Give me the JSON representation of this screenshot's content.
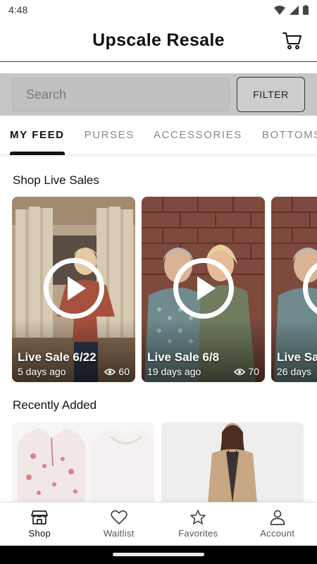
{
  "status_bar": {
    "time": "4:48"
  },
  "header": {
    "title": "Upscale Resale"
  },
  "search": {
    "placeholder": "Search",
    "filter_label": "FILTER"
  },
  "tabs": [
    {
      "label": "MY FEED",
      "active": true
    },
    {
      "label": "PURSES",
      "active": false
    },
    {
      "label": "ACCESSORIES",
      "active": false
    },
    {
      "label": "BOTTOMS",
      "active": false
    }
  ],
  "live_sales": {
    "title": "Shop Live Sales",
    "cards": [
      {
        "title": "Live Sale 6/22",
        "ago": "5 days ago",
        "views": "60"
      },
      {
        "title": "Live Sale 6/8",
        "ago": "19 days ago",
        "views": "70"
      },
      {
        "title": "Live Sa",
        "ago": "26 days",
        "views": ""
      }
    ]
  },
  "recently_added": {
    "title": "Recently Added"
  },
  "bottom_nav": [
    {
      "label": "Shop",
      "icon": "storefront-icon",
      "active": true
    },
    {
      "label": "Waitlist",
      "icon": "heart-icon",
      "active": false
    },
    {
      "label": "Favorites",
      "icon": "star-icon",
      "active": false
    },
    {
      "label": "Account",
      "icon": "person-icon",
      "active": false
    }
  ]
}
